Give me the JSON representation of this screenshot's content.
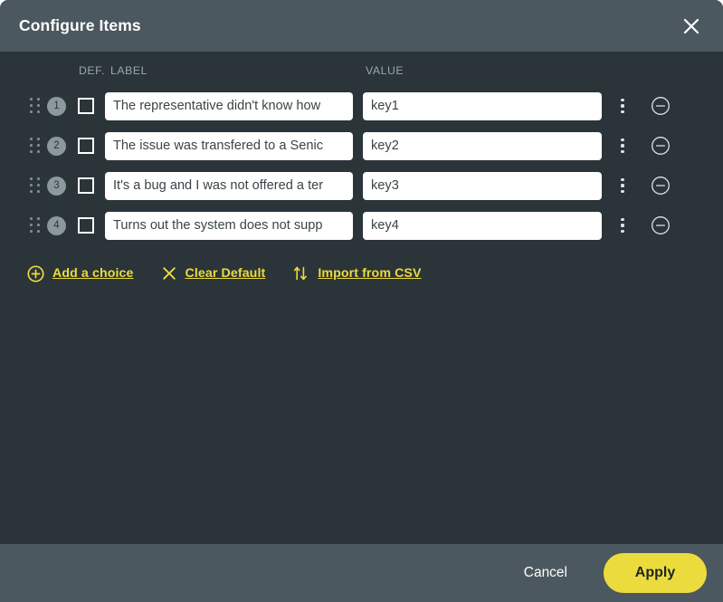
{
  "dialog": {
    "title": "Configure Items",
    "close_icon": "close-icon"
  },
  "colors": {
    "header_bg": "#4c585f",
    "body_bg": "#2a3439",
    "accent": "#ecdb3c",
    "input_bg": "#ffffff",
    "muted_text": "#9aa8ae"
  },
  "table": {
    "headers": {
      "default": "DEF.",
      "label": "LABEL",
      "value": "VALUE"
    },
    "rows": [
      {
        "index": "1",
        "default_checked": false,
        "label": "The representative didn't know how",
        "value": "key1"
      },
      {
        "index": "2",
        "default_checked": false,
        "label": "The issue was transfered to a Senic",
        "value": "key2"
      },
      {
        "index": "3",
        "default_checked": false,
        "label": "It's a bug and I was not offered a ter",
        "value": "key3"
      },
      {
        "index": "4",
        "default_checked": false,
        "label": "Turns out the system does not supp",
        "value": "key4"
      }
    ]
  },
  "actions": {
    "add_choice": "Add a choice",
    "clear_default": "Clear Default",
    "import_csv": "Import from CSV"
  },
  "footer": {
    "cancel": "Cancel",
    "apply": "Apply"
  }
}
